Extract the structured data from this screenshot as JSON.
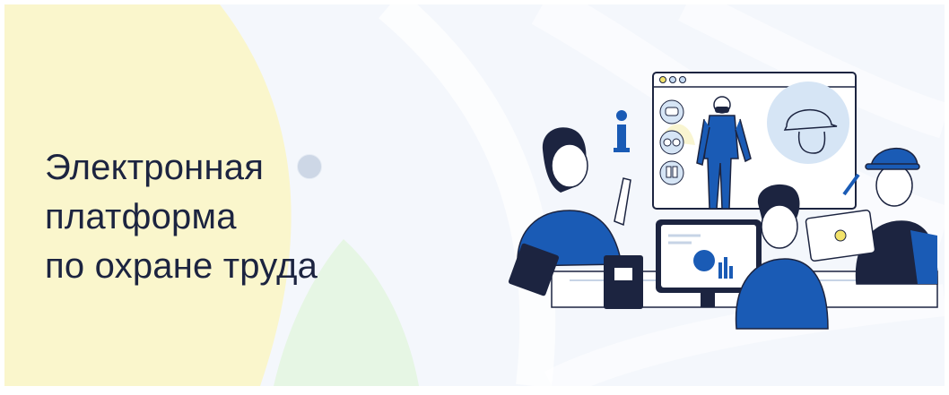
{
  "hero": {
    "headline_lines": [
      "Электронная",
      "платформа",
      "по охране труда"
    ],
    "illustration_icon": "info-icon"
  },
  "colors": {
    "headline": "#1c2440",
    "accent_blue": "#1a5bb5",
    "dark_navy": "#1c2440",
    "yellow_blob": "#faf6cc",
    "green_blob": "#e6f6e4",
    "background": "#f4f7fc"
  }
}
